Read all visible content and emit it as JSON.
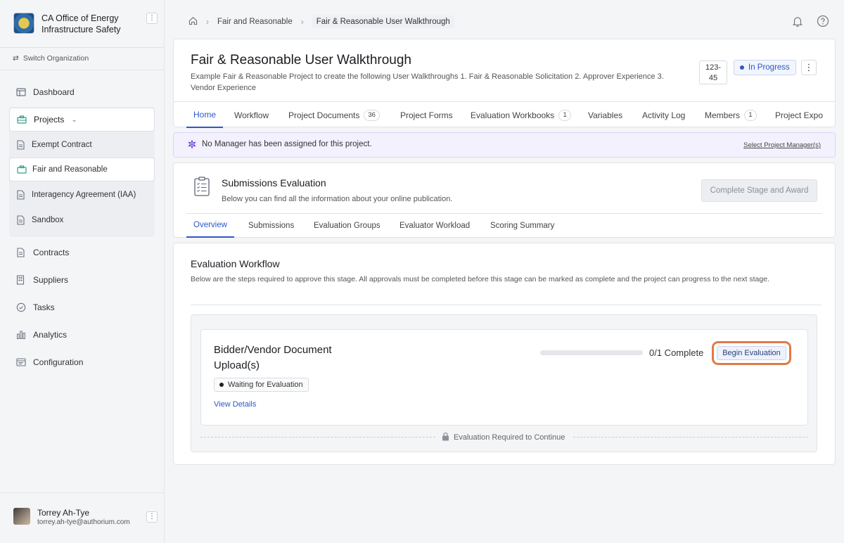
{
  "org": {
    "name": "CA Office of Energy Infrastructure Safety",
    "switch_label": "Switch Organization"
  },
  "sidebar": {
    "items": [
      {
        "label": "Dashboard",
        "icon": "dashboard-icon"
      },
      {
        "label": "Projects",
        "icon": "briefcase-icon"
      },
      {
        "label": "Contracts",
        "icon": "document-icon"
      },
      {
        "label": "Suppliers",
        "icon": "building-icon"
      },
      {
        "label": "Tasks",
        "icon": "check-circle-icon"
      },
      {
        "label": "Analytics",
        "icon": "bar-chart-icon"
      },
      {
        "label": "Configuration",
        "icon": "settings-panel-icon"
      }
    ],
    "projects": [
      {
        "label": "Exempt Contract"
      },
      {
        "label": "Fair and Reasonable"
      },
      {
        "label": "Interagency Agreement (IAA)"
      },
      {
        "label": "Sandbox"
      }
    ]
  },
  "user": {
    "name": "Torrey Ah-Tye",
    "email": "torrey.ah-tye@authorium.com"
  },
  "breadcrumb": {
    "item1": "Fair and Reasonable",
    "current": "Fair & Reasonable User Walkthrough"
  },
  "project": {
    "title": "Fair & Reasonable User Walkthrough",
    "description": "Example Fair & Reasonable Project to create the following User Walkthroughs 1. Fair & Reasonable Solicitation 2. Approver Experience 3. Vendor Experience",
    "id_line1": "123-",
    "id_line2": "45",
    "status": "In Progress"
  },
  "tabs": [
    {
      "label": "Home"
    },
    {
      "label": "Workflow"
    },
    {
      "label": "Project Documents",
      "count": "36"
    },
    {
      "label": "Project Forms"
    },
    {
      "label": "Evaluation Workbooks",
      "count": "1"
    },
    {
      "label": "Variables"
    },
    {
      "label": "Activity Log"
    },
    {
      "label": "Members",
      "count": "1"
    },
    {
      "label": "Project Expo"
    }
  ],
  "alert": {
    "text": "No Manager has been assigned for this project.",
    "link": "Select Project Manager(s)"
  },
  "stage": {
    "title": "Submissions Evaluation",
    "subtitle": "Below you can find all the information about your online publication.",
    "complete_button": "Complete Stage and Award",
    "subtabs": [
      "Overview",
      "Submissions",
      "Evaluation Groups",
      "Evaluator Workload",
      "Scoring Summary"
    ]
  },
  "workflow": {
    "title": "Evaluation Workflow",
    "description": "Below are the steps required to approve this stage. All approvals must be completed before this stage can be marked as complete and the project can progress to the next stage.",
    "step": {
      "title": "Bidder/Vendor Document Upload(s)",
      "status": "Waiting for Evaluation",
      "view_details": "View Details",
      "progress_text": "0/1 Complete",
      "progress_fraction": 0,
      "button": "Begin Evaluation"
    },
    "footer": "Evaluation Required to Continue"
  }
}
